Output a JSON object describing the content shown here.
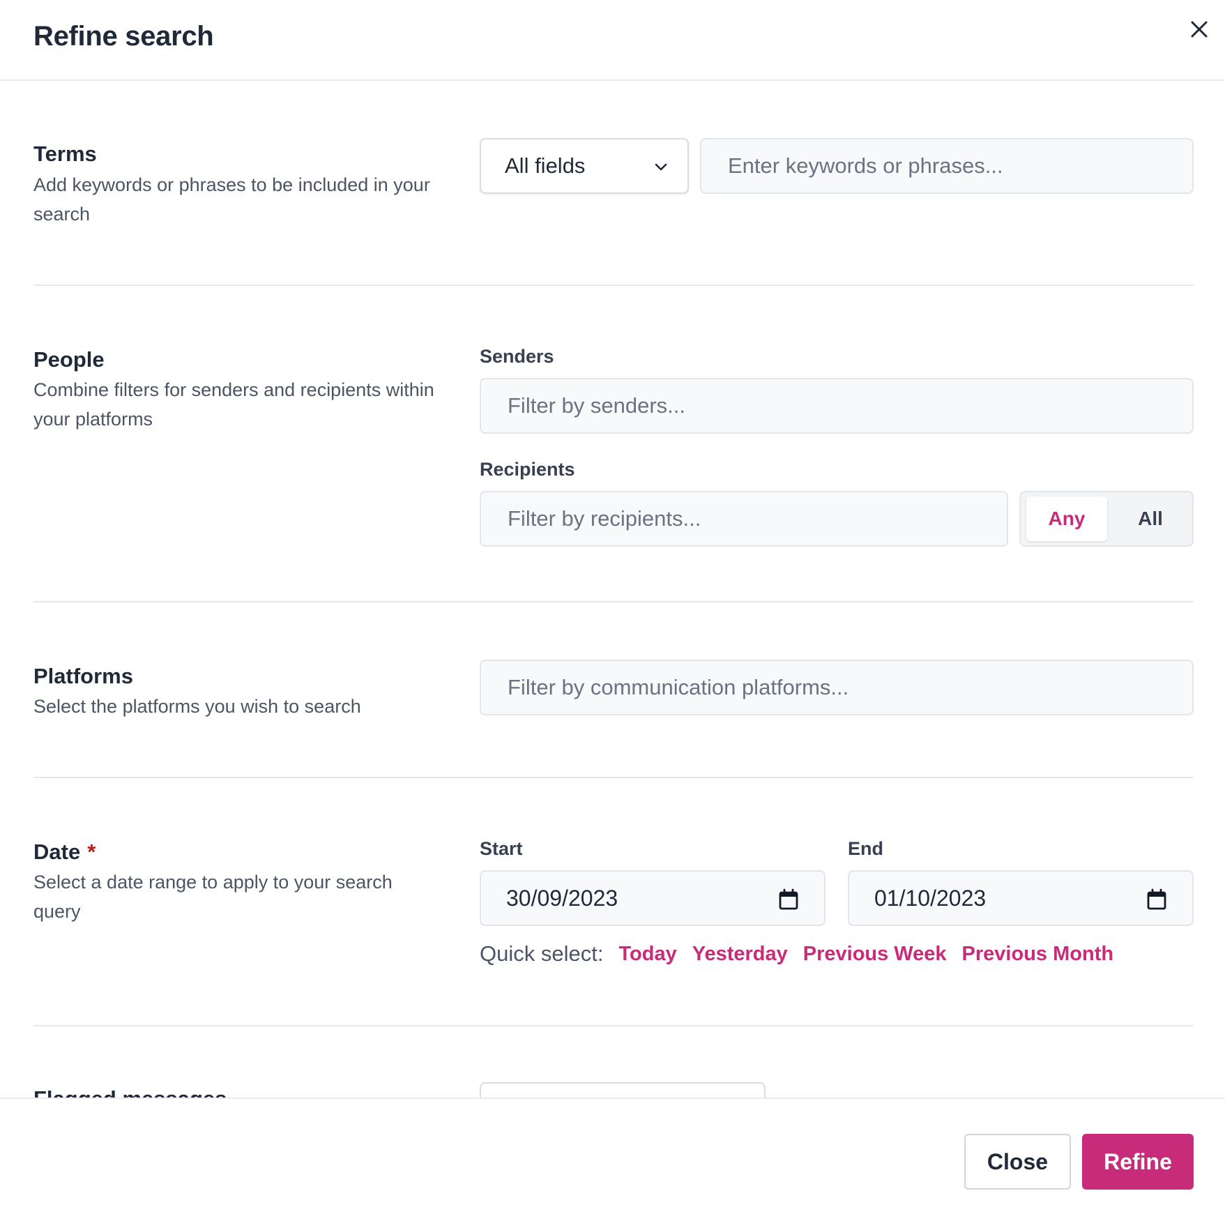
{
  "dialog": {
    "title": "Refine search"
  },
  "terms": {
    "title": "Terms",
    "description": "Add keywords or phrases to be included in your search",
    "field_select": "All fields",
    "keyword_placeholder": "Enter keywords or phrases..."
  },
  "people": {
    "title": "People",
    "description": "Combine filters for senders and recipients within your platforms",
    "senders_label": "Senders",
    "senders_placeholder": "Filter by senders...",
    "recipients_label": "Recipients",
    "recipients_placeholder": "Filter by recipients...",
    "match_any": "Any",
    "match_all": "All"
  },
  "platforms": {
    "title": "Platforms",
    "description": "Select the platforms you wish to search",
    "placeholder": "Filter by communication platforms..."
  },
  "date": {
    "title": "Date",
    "required_mark": "*",
    "description": "Select a date range to apply to your search query",
    "start_label": "Start",
    "start_value": "30/09/2023",
    "end_label": "End",
    "end_value": "01/10/2023",
    "quick_label": "Quick select:",
    "quick_options": [
      "Today",
      "Yesterday",
      "Previous Week",
      "Previous Month"
    ]
  },
  "flagged": {
    "title": "Flagged messages"
  },
  "footer": {
    "close_label": "Close",
    "refine_label": "Refine"
  },
  "colors": {
    "accent": "#c72b7a",
    "required": "#b91c1c"
  }
}
